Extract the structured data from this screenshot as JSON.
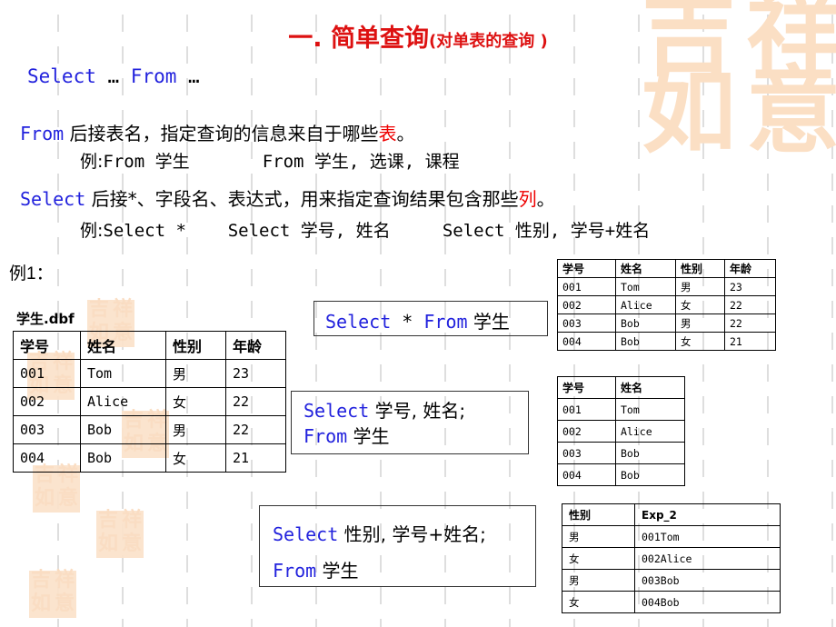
{
  "slide": {
    "title_main": "一. 简单查询",
    "title_sub": "(对单表的查询 )",
    "title_color": "#dd1111",
    "keyword_color": "#2222dd",
    "highlight_color": "#ee0000",
    "watermark_color": "#fbdfc4"
  },
  "watermark": {
    "big_text": "吉祥如意",
    "small_text": "吉祥如意"
  },
  "prose": {
    "syntax_select": "Select",
    "syntax_dots1": " … ",
    "syntax_from": "From",
    "syntax_dots2": " …",
    "from_kw": "From",
    "from_text_a": " 后接表名，指定查询的信息来自于哪些",
    "from_text_hl": "表",
    "from_text_b": "。",
    "from_example_prefix": "例:",
    "from_example_1": "From 学生",
    "from_example_gap": "       ",
    "from_example_2": "From 学生, 选课, 课程",
    "select_kw": "Select",
    "select_text_a": " 后接*、字段名、表达式，用来指定查询结果包含那些",
    "select_text_hl": "列",
    "select_text_b": "。",
    "select_example_prefix": "例:",
    "select_example_1": "Select *",
    "select_example_gap1": "    ",
    "select_example_2": "Select 学号, 姓名",
    "select_example_gap2": "     ",
    "select_example_3": "Select  性别, 学号+姓名",
    "example_label": "例1：",
    "dbf_label": "学生.dbf"
  },
  "sql_boxes": [
    {
      "name": "select-star-from-students",
      "lines": [
        [
          {
            "t": "Select",
            "k": "kw"
          },
          {
            "t": " * ",
            "k": "mono"
          },
          {
            "t": "From",
            "k": "kw"
          },
          {
            "t": " 学生",
            "k": "tx"
          }
        ]
      ]
    },
    {
      "name": "select-id-name-from-students",
      "lines": [
        [
          {
            "t": "Select",
            "k": "kw"
          },
          {
            "t": " 学号, 姓名;",
            "k": "tx"
          }
        ],
        [
          {
            "t": "From",
            "k": "kw"
          },
          {
            "t": " 学生",
            "k": "tx"
          }
        ]
      ]
    },
    {
      "name": "select-gender-idplusname-from-students",
      "lines": [
        [
          {
            "t": "Select",
            "k": "kw"
          },
          {
            "t": " 性别, 学号+姓名;",
            "k": "tx"
          }
        ],
        [
          {
            "t": "From",
            "k": "kw"
          },
          {
            "t": " 学生",
            "k": "tx"
          }
        ]
      ]
    }
  ],
  "tables": {
    "students": {
      "caption": "学生.dbf",
      "headers": [
        "学号",
        "姓名",
        "性别",
        "年龄"
      ],
      "rows": [
        [
          "001",
          "Tom",
          "男",
          "23"
        ],
        [
          "002",
          "Alice",
          "女",
          "22"
        ],
        [
          "003",
          "Bob",
          "男",
          "22"
        ],
        [
          "004",
          "Bob",
          "女",
          "21"
        ]
      ]
    },
    "result1": {
      "headers": [
        "学号",
        "姓名",
        "性别",
        "年龄"
      ],
      "rows": [
        [
          "001",
          "Tom",
          "男",
          "23"
        ],
        [
          "002",
          "Alice",
          "女",
          "22"
        ],
        [
          "003",
          "Bob",
          "男",
          "22"
        ],
        [
          "004",
          "Bob",
          "女",
          "21"
        ]
      ]
    },
    "result2": {
      "headers": [
        "学号",
        "姓名"
      ],
      "rows": [
        [
          "001",
          "Tom"
        ],
        [
          "002",
          "Alice"
        ],
        [
          "003",
          "Bob"
        ],
        [
          "004",
          "Bob"
        ]
      ]
    },
    "result3": {
      "headers": [
        "性别",
        "Exp_2"
      ],
      "rows": [
        [
          "男",
          "001Tom"
        ],
        [
          "女",
          "002Alice"
        ],
        [
          "男",
          "003Bob"
        ],
        [
          "女",
          "004Bob"
        ]
      ]
    }
  }
}
